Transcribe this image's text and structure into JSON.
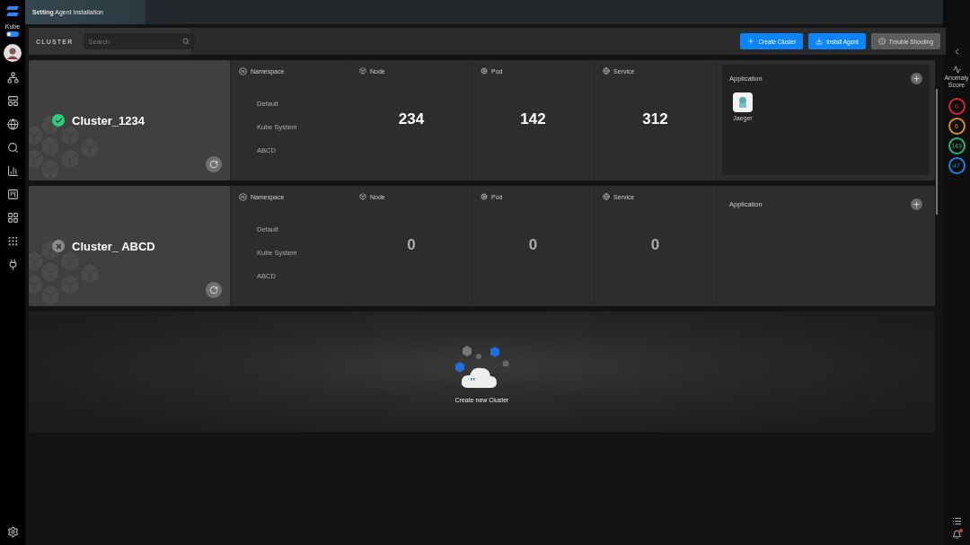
{
  "top_bar": {
    "tab_title": "**Setting** Agent Installation"
  },
  "sidebar": {
    "workspace": "Kube",
    "toggle_on": true
  },
  "toolbar": {
    "label": "CLUSTER",
    "search": {
      "placeholder": "Search"
    },
    "buttons": [
      {
        "label": "Create Cluster",
        "kind": "primary"
      },
      {
        "label": "Install Agent",
        "kind": "primary"
      },
      {
        "label": "Trouble Shooting",
        "kind": "secondary"
      }
    ]
  },
  "clusters": [
    {
      "name": "Cluster_1234",
      "healthy": true,
      "namespace_title": "Namespace",
      "namespaces": [
        "Default",
        "Kube System",
        "ABCD"
      ],
      "stats": [
        {
          "kind": "node",
          "label": "Node",
          "value": "234"
        },
        {
          "kind": "pod",
          "label": "Pod",
          "value": "142"
        },
        {
          "kind": "service",
          "label": "Service",
          "value": "312"
        }
      ],
      "application_title": "Application",
      "applications": [
        {
          "name": "Jaeger"
        }
      ]
    },
    {
      "name": "Cluster_ ABCD",
      "healthy": false,
      "namespace_title": "Namespace",
      "namespaces": [
        "Default",
        "Kube System",
        "ABCD"
      ],
      "stats": [
        {
          "kind": "node",
          "label": "Node",
          "value": "0"
        },
        {
          "kind": "pod",
          "label": "Pod",
          "value": "0"
        },
        {
          "kind": "service",
          "label": "Service",
          "value": "0"
        }
      ],
      "application_title": "Application"
    }
  ],
  "create_card": {
    "label": "Create new Cluster"
  },
  "right_rail": {
    "title": "Anomaly Score",
    "scores": [
      {
        "value": "0",
        "color": "#d3263a"
      },
      {
        "value": "6",
        "color": "#d98a1c"
      },
      {
        "value": "149",
        "color": "#22b573"
      },
      {
        "value": "47",
        "color": "#1f7fe0"
      }
    ]
  }
}
